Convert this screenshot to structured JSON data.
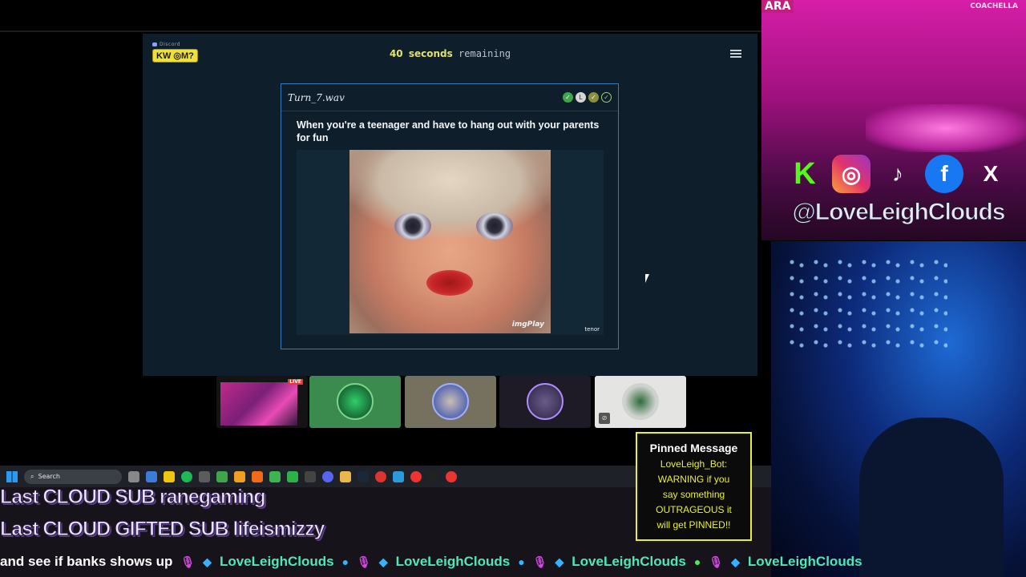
{
  "activity": {
    "brand_small": "Discord",
    "brand_name": "KW ◎M?",
    "timer_number": "40",
    "timer_bold": "seconds",
    "timer_rest": "remaining",
    "card": {
      "filename": "Turn_7.wav",
      "prompt": "When you're a teenager and have to hang out with your parents for fun",
      "gif_watermark": "imgPlay",
      "gif_credit": "tenor"
    },
    "badges": [
      "✓",
      "L",
      "✓",
      "✓"
    ]
  },
  "participants": [
    {
      "name": "streamer-screen",
      "live_label": "LIVE"
    },
    {
      "name": "participant-2"
    },
    {
      "name": "participant-3"
    },
    {
      "name": "participant-4"
    },
    {
      "name": "participant-5"
    }
  ],
  "overlay": {
    "coachella_tag": "COACHELLA",
    "ara_tag": "ARA",
    "handle": "@LoveLeighClouds",
    "socials": [
      "K",
      "◎",
      "♪",
      "f",
      "X"
    ]
  },
  "taskbar": {
    "search_placeholder": "Search"
  },
  "subs": {
    "last_sub": "Last CLOUD SUB ranegaming",
    "last_gifted": "Last CLOUD GIFTED SUB lifeismizzy"
  },
  "ticker": {
    "message": "and see if banks shows up",
    "name": "LoveLeighClouds"
  },
  "pinned": {
    "title": "Pinned Message",
    "body_lines": [
      "LoveLeigh_Bot:",
      "WARNING if you",
      "say something",
      "OUTRAGEOUS it",
      "will get PINNED!!"
    ]
  }
}
